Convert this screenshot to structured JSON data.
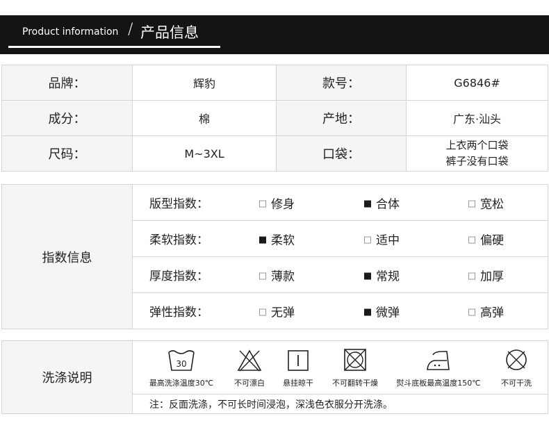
{
  "header": {
    "title_en": "Product information",
    "title_zh": "产品信息"
  },
  "product": {
    "rows": [
      [
        {
          "label": "品牌：",
          "value": "辉豹"
        },
        {
          "label": "款号：",
          "value": "G6846#"
        }
      ],
      [
        {
          "label": "成分：",
          "value": "棉"
        },
        {
          "label": "产地：",
          "value": "广东·汕头"
        }
      ],
      [
        {
          "label": "尺码：",
          "value": "M~3XL"
        },
        {
          "label": "口袋：",
          "value_lines": [
            "上衣两个口袋",
            "裤子没有口袋"
          ]
        }
      ]
    ]
  },
  "index": {
    "title": "指数信息",
    "rows": [
      {
        "label": "版型指数：",
        "options": [
          {
            "text": "修身",
            "selected": false
          },
          {
            "text": "合体",
            "selected": true
          },
          {
            "text": "宽松",
            "selected": false
          }
        ]
      },
      {
        "label": "柔软指数：",
        "options": [
          {
            "text": "柔软",
            "selected": true
          },
          {
            "text": "适中",
            "selected": false
          },
          {
            "text": "偏硬",
            "selected": false
          }
        ]
      },
      {
        "label": "厚度指数：",
        "options": [
          {
            "text": "薄款",
            "selected": false
          },
          {
            "text": "常规",
            "selected": true
          },
          {
            "text": "加厚",
            "selected": false
          }
        ]
      },
      {
        "label": "弹性指数：",
        "options": [
          {
            "text": "无弹",
            "selected": false
          },
          {
            "text": "微弹",
            "selected": true
          },
          {
            "text": "高弹",
            "selected": false
          }
        ]
      }
    ]
  },
  "care": {
    "title": "洗涤说明",
    "icons": [
      {
        "name": "wash-30-icon",
        "number": "30",
        "label": "最高洗涤温度30℃"
      },
      {
        "name": "no-bleach-icon",
        "label": "不可漂白"
      },
      {
        "name": "line-dry-icon",
        "label": "悬挂晾干"
      },
      {
        "name": "no-tumble-dry-icon",
        "label": "不可翻转干燥"
      },
      {
        "name": "iron-icon",
        "label": "熨斗底板最高温度150℃"
      },
      {
        "name": "no-dry-clean-icon",
        "label": "不可干洗"
      }
    ],
    "note": "注：反面洗涤，不可长时间浸泡，深浅色衣服分开洗涤。"
  }
}
